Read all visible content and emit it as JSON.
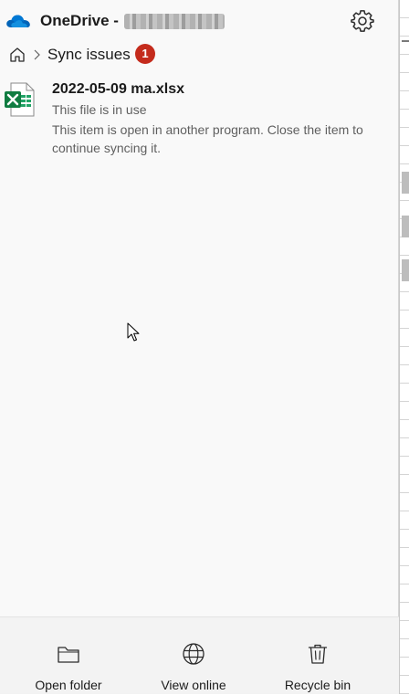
{
  "header": {
    "app_title": "OneDrive -",
    "icons": {
      "logo": "onedrive-cloud-icon",
      "settings": "gear-icon"
    },
    "accent_color": "#0364b8"
  },
  "breadcrumb": {
    "home_icon": "home-icon",
    "separator_icon": "chevron-right-icon",
    "current": "Sync issues",
    "badge_count": "1",
    "badge_color": "#c42b1c"
  },
  "issues": [
    {
      "icon": "excel-file-icon",
      "file_name": "2022-05-09 ma.xlsx",
      "status": "This file is in use",
      "message": "This item is open in another program. Close the item to continue syncing it."
    }
  ],
  "footer": {
    "buttons": [
      {
        "icon": "folder-icon",
        "label": "Open folder"
      },
      {
        "icon": "globe-icon",
        "label": "View online"
      },
      {
        "icon": "trash-icon",
        "label": "Recycle bin"
      }
    ]
  }
}
